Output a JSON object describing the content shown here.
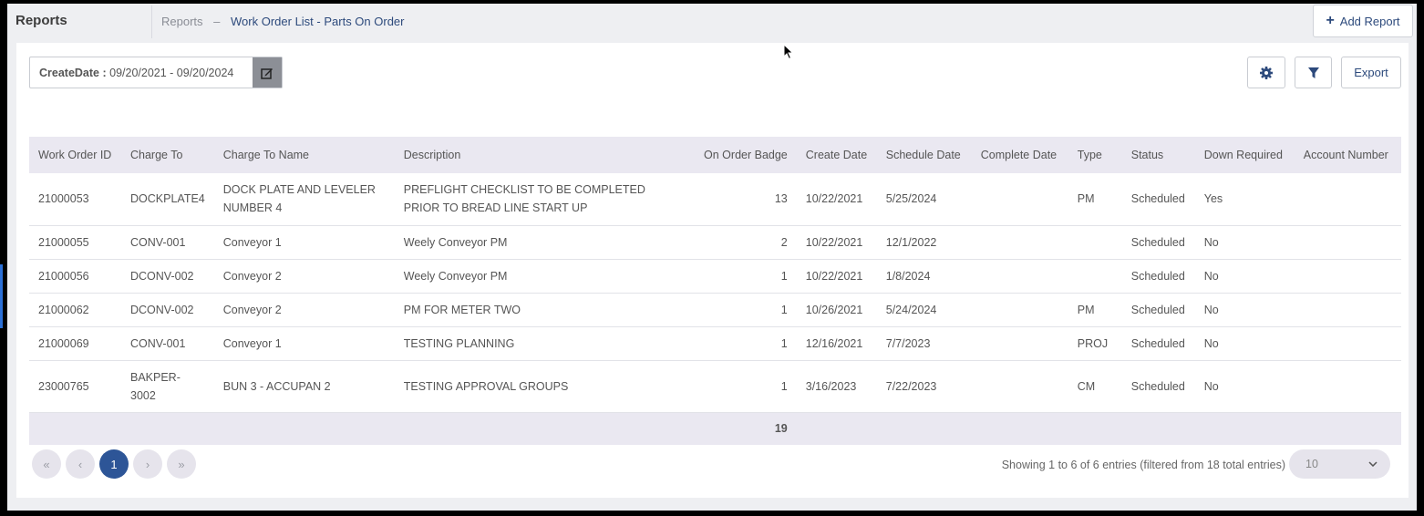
{
  "header": {
    "app_title": "Reports",
    "breadcrumb_root": "Reports",
    "breadcrumb_sep": "–",
    "breadcrumb_current": "Work Order List - Parts On Order",
    "add_report_label": "Add Report"
  },
  "filter": {
    "label": "CreateDate :",
    "value": "09/20/2021 - 09/20/2024"
  },
  "toolbar": {
    "export_label": "Export"
  },
  "table": {
    "columns": [
      "Work Order ID",
      "Charge To",
      "Charge To Name",
      "Description",
      "On Order Badge",
      "Create Date",
      "Schedule Date",
      "Complete Date",
      "Type",
      "Status",
      "Down Required",
      "Account Number"
    ],
    "rows": [
      [
        "21000053",
        "DOCKPLATE4",
        "DOCK PLATE AND LEVELER NUMBER 4",
        "PREFLIGHT CHECKLIST TO BE COMPLETED PRIOR TO BREAD LINE START UP",
        "13",
        "10/22/2021",
        "5/25/2024",
        "",
        "PM",
        "Scheduled",
        "Yes",
        ""
      ],
      [
        "21000055",
        "CONV-001",
        "Conveyor 1",
        "Weely Conveyor PM",
        "2",
        "10/22/2021",
        "12/1/2022",
        "",
        "",
        "Scheduled",
        "No",
        ""
      ],
      [
        "21000056",
        "DCONV-002",
        "Conveyor 2",
        "Weely Conveyor PM",
        "1",
        "10/22/2021",
        "1/8/2024",
        "",
        "",
        "Scheduled",
        "No",
        ""
      ],
      [
        "21000062",
        "DCONV-002",
        "Conveyor 2",
        "PM FOR METER TWO",
        "1",
        "10/26/2021",
        "5/24/2024",
        "",
        "PM",
        "Scheduled",
        "No",
        ""
      ],
      [
        "21000069",
        "CONV-001",
        "Conveyor 1",
        "TESTING PLANNING",
        "1",
        "12/16/2021",
        "7/7/2023",
        "",
        "PROJ",
        "Scheduled",
        "No",
        ""
      ],
      [
        "23000765",
        "BAKPER-3002",
        "BUN 3 - ACCUPAN 2",
        "TESTING APPROVAL GROUPS",
        "1",
        "3/16/2023",
        "7/22/2023",
        "",
        "CM",
        "Scheduled",
        "No",
        ""
      ]
    ],
    "total_badge": "19"
  },
  "pagination": {
    "current_page": "1",
    "entries_text": "Showing 1 to 6 of 6 entries (filtered from 18 total entries)",
    "page_size": "10"
  },
  "icons": [
    "edit-icon",
    "gear-icon",
    "filter-icon",
    "plus-icon",
    "first-page-icon",
    "prev-page-icon",
    "next-page-icon",
    "last-page-icon",
    "chevron-down-icon",
    "mouse-cursor-icon"
  ],
  "colors": {
    "accent": "#2d5597",
    "header_bg": "#eae8f1",
    "link": "#2d4a7c"
  }
}
